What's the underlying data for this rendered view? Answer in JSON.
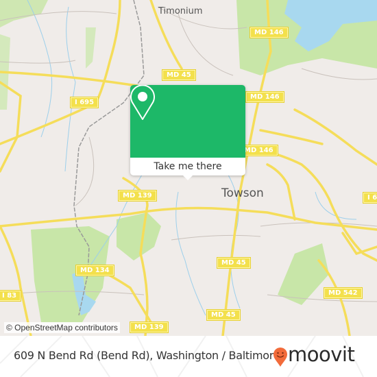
{
  "map": {
    "place_labels": [
      {
        "id": "timonium",
        "text": "Timonium"
      },
      {
        "id": "towson",
        "text": "Towson"
      }
    ],
    "road_shields": [
      {
        "id": "md45-north",
        "text": "MD 45"
      },
      {
        "id": "md146-top",
        "text": "MD 146"
      },
      {
        "id": "md146-mid",
        "text": "MD 146"
      },
      {
        "id": "md146-low",
        "text": "MD 146"
      },
      {
        "id": "i695-west",
        "text": "I 695"
      },
      {
        "id": "i695-east",
        "text": "I 6"
      },
      {
        "id": "md139-mid",
        "text": "MD 139"
      },
      {
        "id": "md134",
        "text": "MD 134"
      },
      {
        "id": "i83",
        "text": "I 83"
      },
      {
        "id": "md45-mid",
        "text": "MD 45"
      },
      {
        "id": "md45-south",
        "text": "MD 45"
      },
      {
        "id": "md542",
        "text": "MD 542"
      },
      {
        "id": "md139-bottom",
        "text": "MD 139"
      }
    ],
    "attribution": "© OpenStreetMap contributors",
    "colors": {
      "land": "#f0ece9",
      "park": "#c8e6a8",
      "water": "#a8d8ef",
      "road": "#f5dd5a",
      "shield": "#f3e04c"
    }
  },
  "popup": {
    "icon": "map-pin-icon",
    "button_label": "Take me there",
    "color": "#1db868"
  },
  "footer": {
    "address": "609 N Bend Rd (Bend Rd), Washington / Baltimore",
    "logo_text": "moovit",
    "logo_icon": "moovit-smiley-pin-icon",
    "logo_color": "#f26b3a"
  }
}
